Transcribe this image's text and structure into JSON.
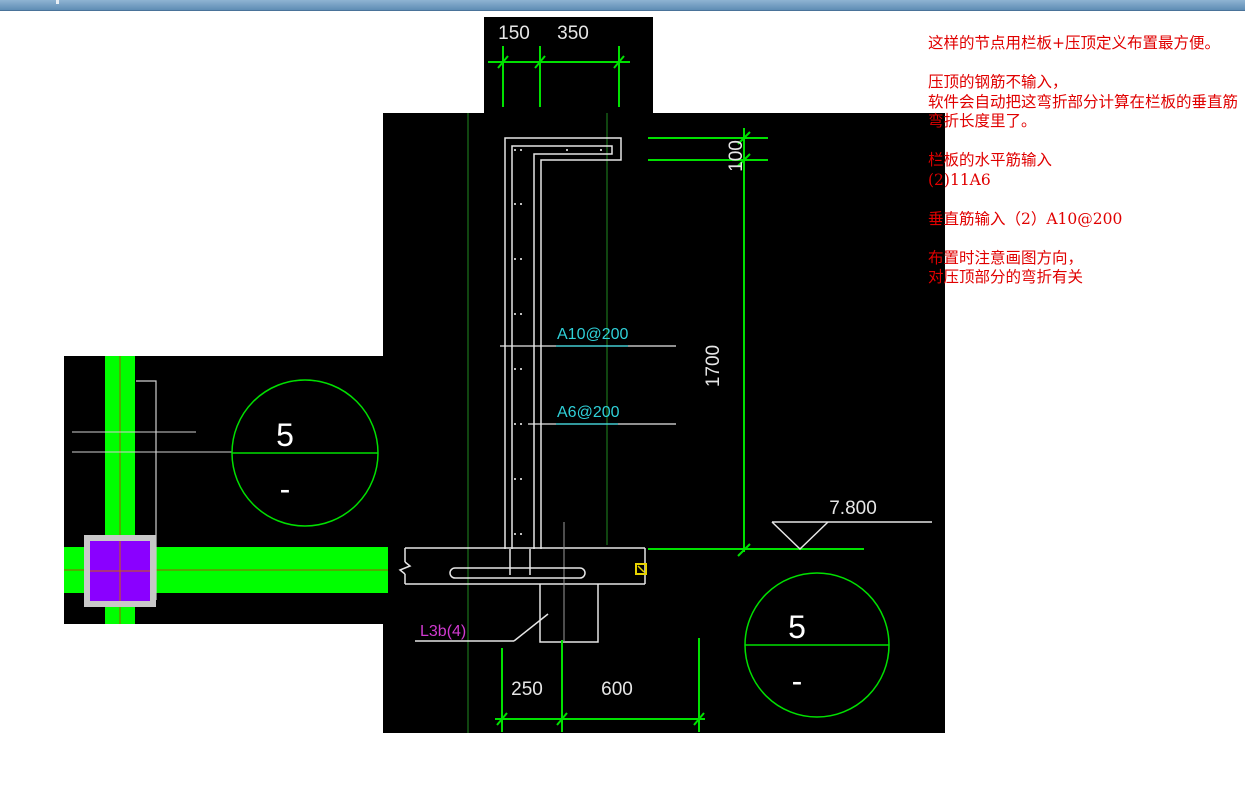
{
  "window": {
    "accent": "#6e97bb"
  },
  "drawing": {
    "dims_top": [
      "150",
      "350"
    ],
    "dim_height_top": "100",
    "dim_height_main": "1700",
    "rebar_vertical": "A10@200",
    "rebar_horizontal": "A6@200",
    "elevation": "7.800",
    "beam_label": "L3b(4)",
    "dims_bottom": [
      "250",
      "600"
    ],
    "section_left": {
      "number": "5",
      "sub": "-"
    },
    "section_right": {
      "number": "5",
      "sub": "-"
    },
    "colors": {
      "background": "#000000",
      "dim_green": "#00e000",
      "beam_fill": "#00ff00",
      "column_fill": "#7f00ff",
      "rebar_label": "#2fd0d8",
      "beam_label": "#d13ad1",
      "note_text": "#e00000"
    }
  },
  "notes": [
    "这样的节点用栏板+压顶定义布置最方便。",
    "压顶的钢筋不输入，",
    "软件会自动把这弯折部分计算在栏板的垂直筋弯折长度里了。",
    "栏板的水平筋输入",
    "(2)11A6",
    "垂直筋输入（2）A10@200",
    "布置时注意画图方向，",
    "对压顶部分的弯折有关"
  ]
}
